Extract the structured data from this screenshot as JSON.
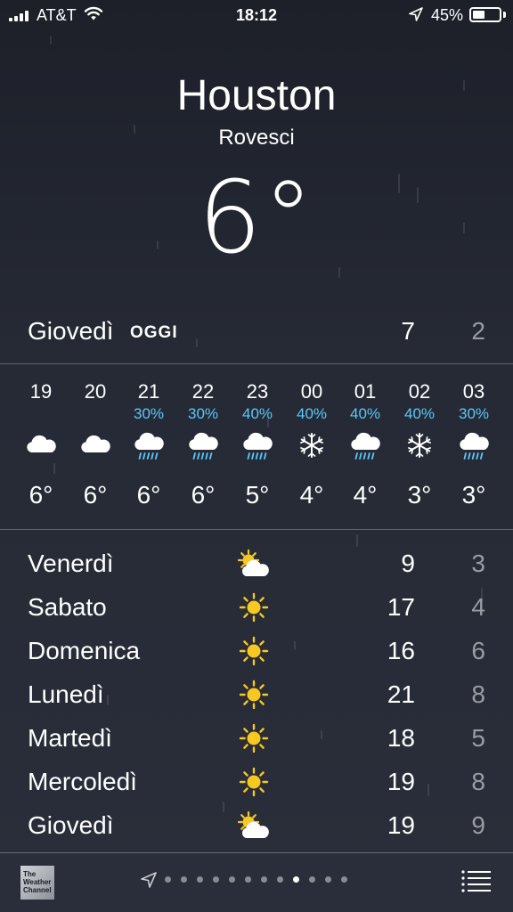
{
  "status_bar": {
    "carrier": "AT&T",
    "time": "18:12",
    "battery_percent": "45%",
    "battery_level": 0.45
  },
  "location": {
    "city": "Houston",
    "condition": "Rovesci",
    "temperature": "6°"
  },
  "today": {
    "day": "Giovedì",
    "tag": "OGGI",
    "high": "7",
    "low": "2"
  },
  "hourly": [
    {
      "hour": "19",
      "precip": "",
      "icon": "cloud-icon",
      "temp": "6°"
    },
    {
      "hour": "20",
      "precip": "",
      "icon": "cloud-icon",
      "temp": "6°"
    },
    {
      "hour": "21",
      "precip": "30%",
      "icon": "rain-cloud-icon",
      "temp": "6°"
    },
    {
      "hour": "22",
      "precip": "30%",
      "icon": "rain-cloud-icon",
      "temp": "6°"
    },
    {
      "hour": "23",
      "precip": "40%",
      "icon": "rain-cloud-icon",
      "temp": "5°"
    },
    {
      "hour": "00",
      "precip": "40%",
      "icon": "snowflake-icon",
      "temp": "4°"
    },
    {
      "hour": "01",
      "precip": "40%",
      "icon": "rain-cloud-icon",
      "temp": "4°"
    },
    {
      "hour": "02",
      "precip": "40%",
      "icon": "snowflake-icon",
      "temp": "3°"
    },
    {
      "hour": "03",
      "precip": "30%",
      "icon": "rain-cloud-icon",
      "temp": "3°"
    }
  ],
  "daily": [
    {
      "day": "Venerdì",
      "icon": "partly-cloudy-icon",
      "high": "9",
      "low": "3"
    },
    {
      "day": "Sabato",
      "icon": "sun-icon",
      "high": "17",
      "low": "4"
    },
    {
      "day": "Domenica",
      "icon": "sun-icon",
      "high": "16",
      "low": "6"
    },
    {
      "day": "Lunedì",
      "icon": "sun-icon",
      "high": "21",
      "low": "8"
    },
    {
      "day": "Martedì",
      "icon": "sun-icon",
      "high": "18",
      "low": "5"
    },
    {
      "day": "Mercoledì",
      "icon": "sun-icon",
      "high": "19",
      "low": "8"
    },
    {
      "day": "Giovedì",
      "icon": "partly-cloudy-icon",
      "high": "19",
      "low": "9"
    }
  ],
  "bottom_bar": {
    "logo_text": "The Weather Channel",
    "page_count": 12,
    "active_page": 9
  },
  "colors": {
    "precip_blue": "#5ac8fa",
    "sun_yellow": "#f7c722",
    "low_temp_gray": "#9a9ca4"
  }
}
